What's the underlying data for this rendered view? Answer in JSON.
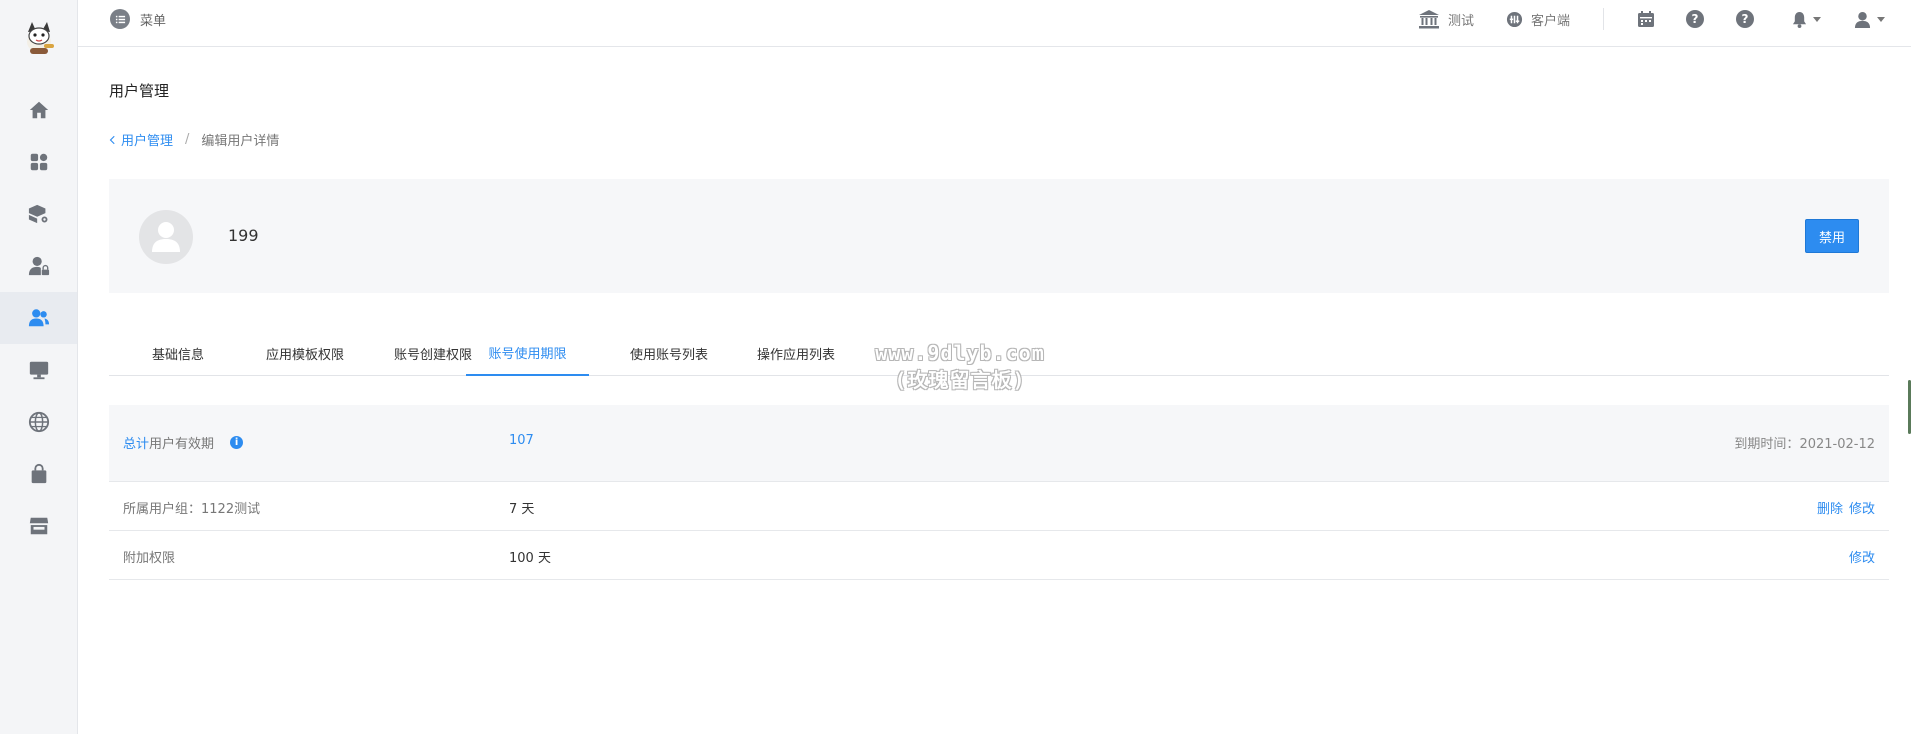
{
  "colors": {
    "accent": "#2d8cf0",
    "sidebar_bg": "#f4f5f7",
    "card_bg": "#f6f7f9"
  },
  "header": {
    "menu_label": "菜单",
    "test_label": "测试",
    "client_label": "客户端",
    "icons": [
      "bank-icon",
      "dashboard-icon",
      "calendar-icon",
      "help-icon",
      "help-icon",
      "bell-icon",
      "user-icon"
    ]
  },
  "sidebar": {
    "items": [
      {
        "icon": "home-icon"
      },
      {
        "icon": "apps-icon"
      },
      {
        "icon": "package-settings-icon"
      },
      {
        "icon": "user-lock-icon"
      },
      {
        "icon": "users-icon",
        "active": true
      },
      {
        "icon": "monitor-icon"
      },
      {
        "icon": "globe-icon"
      },
      {
        "icon": "shopping-bag-icon"
      },
      {
        "icon": "store-icon"
      }
    ]
  },
  "page": {
    "title": "用户管理",
    "breadcrumb": {
      "back_label": "用户管理",
      "separator": "/",
      "current": "编辑用户详情"
    }
  },
  "profile": {
    "username": "199",
    "disable_label": "禁用"
  },
  "tabs": [
    {
      "label": "基础信息"
    },
    {
      "label": "应用模板权限"
    },
    {
      "label": "账号创建权限"
    },
    {
      "label": "账号使用期限",
      "active": true
    },
    {
      "label": "使用账号列表"
    },
    {
      "label": "操作应用列表"
    }
  ],
  "watermark": {
    "line1": "www.9dlyb.com",
    "line2": "(玫瑰留言板)"
  },
  "validity": {
    "summary": {
      "label_highlight": "总计",
      "label_rest": "用户有效期",
      "value": "107",
      "expiry_label": "到期时间：",
      "expiry_date": "2021-02-12"
    },
    "rows": [
      {
        "label": "所属用户组：1122测试",
        "value": "7 天",
        "actions": [
          "删除",
          "修改"
        ]
      },
      {
        "label": "附加权限",
        "value": "100 天",
        "actions": [
          "修改"
        ]
      }
    ]
  }
}
